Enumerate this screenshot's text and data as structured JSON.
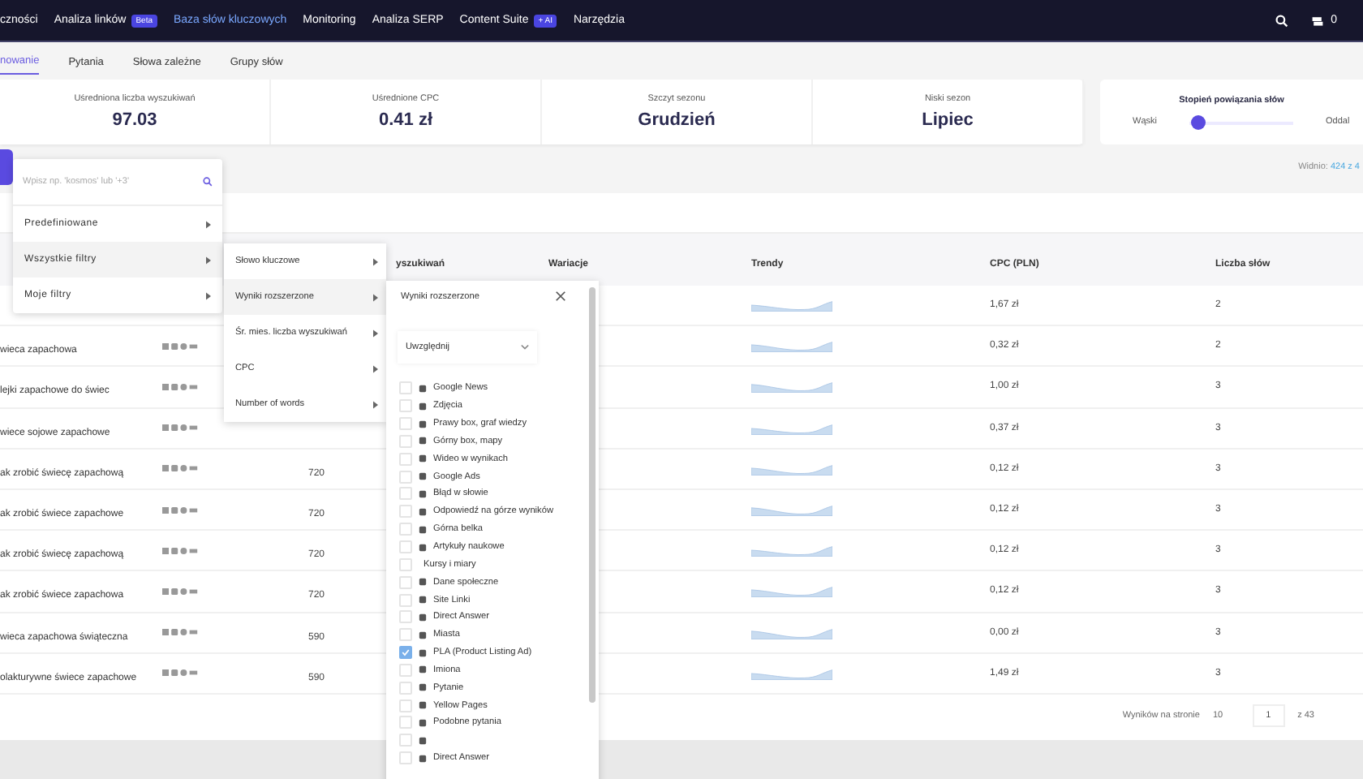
{
  "nav": {
    "items": [
      {
        "label": "czności",
        "selected": false
      },
      {
        "label": "Analiza linków",
        "badge": "Beta",
        "selected": false
      },
      {
        "label": "Baza słów kluczowych",
        "selected": true
      },
      {
        "label": "Monitoring",
        "selected": false
      },
      {
        "label": "Analiza SERP",
        "selected": false
      },
      {
        "label": "Content Suite",
        "badge": "+ AI",
        "selected": false
      },
      {
        "label": "Narzędzia",
        "selected": false
      }
    ],
    "credits": "0"
  },
  "subtabs": [
    {
      "label": "nowanie",
      "selected": true
    },
    {
      "label": "Pytania",
      "selected": false
    },
    {
      "label": "Słowa zależne",
      "selected": false
    },
    {
      "label": "Grupy słów",
      "selected": false
    }
  ],
  "stats": [
    {
      "label": "Uśredniona liczba wyszukiwań",
      "value": "97.03"
    },
    {
      "label": "Uśrednione CPC",
      "value": "0.41 zł"
    },
    {
      "label": "Szczyt sezonu",
      "value": "Grudzień"
    },
    {
      "label": "Niski sezon",
      "value": "Lipiec"
    }
  ],
  "relation": {
    "title": "Stopień powiązania słów",
    "left": "Wąski",
    "right": "Oddal",
    "level": 0.02
  },
  "visible": {
    "label": "Widnio:",
    "value": "424 z 4"
  },
  "table": {
    "columns": [
      "yszukiwań",
      "Wariacje",
      "Trendy",
      "CPC (PLN)",
      "Liczba słów"
    ],
    "rows": [
      {
        "cpc": "1,67 zł",
        "words": "2"
      },
      {
        "keyword": "wieca zapachowa",
        "cpc": "0,32 zł",
        "words": "2"
      },
      {
        "keyword": "lejki zapachowe do świec",
        "cpc": "1,00 zł",
        "words": "3"
      },
      {
        "keyword": "wiece sojowe zapachowe",
        "cpc": "0,37 zł",
        "words": "3"
      },
      {
        "keyword": "ak zrobić świecę zapachową",
        "volume": "720",
        "cpc": "0,12 zł",
        "words": "3"
      },
      {
        "keyword": "ak zrobić świece zapachowe",
        "volume": "720",
        "cpc": "0,12 zł",
        "words": "3"
      },
      {
        "keyword": "ak zrobić świecę zapachową",
        "volume": "720",
        "cpc": "0,12 zł",
        "words": "3"
      },
      {
        "keyword": "ak zrobić świece zapachowa",
        "volume": "720",
        "cpc": "0,12 zł",
        "words": "3"
      },
      {
        "keyword": "wieca zapachowa świąteczna",
        "volume": "590",
        "cpc": "0,00 zł",
        "words": "3"
      },
      {
        "keyword": "olakturywne świece zapachowe",
        "volume": "590",
        "cpc": "1,49 zł",
        "words": "3"
      }
    ]
  },
  "pagination": {
    "label": "Wyników na stronie",
    "per_page": "10",
    "page": "1",
    "total": "z 43"
  },
  "filter_menu": {
    "placeholder": "Wpisz np. 'kosmos' lub '+3'",
    "items": [
      {
        "label": "Predefiniowane",
        "selected": false
      },
      {
        "label": "Wszystkie filtry",
        "selected": true
      },
      {
        "label": "Moje filtry",
        "selected": false
      }
    ]
  },
  "filter_submenu": {
    "items": [
      {
        "label": "Słowo kluczowe",
        "selected": false
      },
      {
        "label": "Wyniki rozszerzone",
        "selected": true
      },
      {
        "label": "Śr. mies. liczba wyszukiwań",
        "selected": false
      },
      {
        "label": "CPC",
        "selected": false
      },
      {
        "label": "Number of words",
        "selected": false
      }
    ]
  },
  "serp_panel": {
    "title": "Wyniki rozszerzone",
    "mode": "Uwzględnij",
    "options": [
      {
        "kind": "icon",
        "label": "Google News",
        "checked": false
      },
      {
        "kind": "icon",
        "label": "Zdjęcia",
        "checked": false
      },
      {
        "kind": "icon",
        "label": "Prawy box, graf wiedzy",
        "checked": false
      },
      {
        "kind": "icon",
        "label": "Górny box, mapy",
        "checked": false
      },
      {
        "kind": "icon",
        "label": "Wideo w wynikach",
        "checked": false
      },
      {
        "kind": "icon",
        "label": "Google Ads",
        "checked": false
      },
      {
        "kind": "icon",
        "label": "Błąd w słowie",
        "checked": false
      },
      {
        "kind": "icon",
        "label": "Odpowiedź na górze wyników",
        "checked": false
      },
      {
        "kind": "icon",
        "label": "Górna belka",
        "checked": false
      },
      {
        "kind": "icon",
        "label": "Artykuły naukowe",
        "checked": false
      },
      {
        "kind": "text",
        "label": "Kursy i miary",
        "checked": false
      },
      {
        "kind": "icon",
        "label": "Dane społeczne",
        "checked": false
      },
      {
        "kind": "icon",
        "label": "Site Linki",
        "checked": false
      },
      {
        "kind": "icon",
        "label": "Direct Answer",
        "checked": false
      },
      {
        "kind": "icon",
        "label": "Miasta",
        "checked": false
      },
      {
        "kind": "icon",
        "label": "PLA (Product Listing Ad)",
        "checked": true
      },
      {
        "kind": "icon",
        "label": "Imiona",
        "checked": false
      },
      {
        "kind": "icon",
        "label": "Pytanie",
        "checked": false
      },
      {
        "kind": "icon",
        "label": "Yellow Pages",
        "checked": false
      },
      {
        "kind": "icon",
        "label": "Podobne pytania",
        "checked": false
      },
      {
        "kind": "bare",
        "checked": false
      },
      {
        "kind": "icon",
        "label": "Direct Answer",
        "checked": false
      }
    ]
  }
}
